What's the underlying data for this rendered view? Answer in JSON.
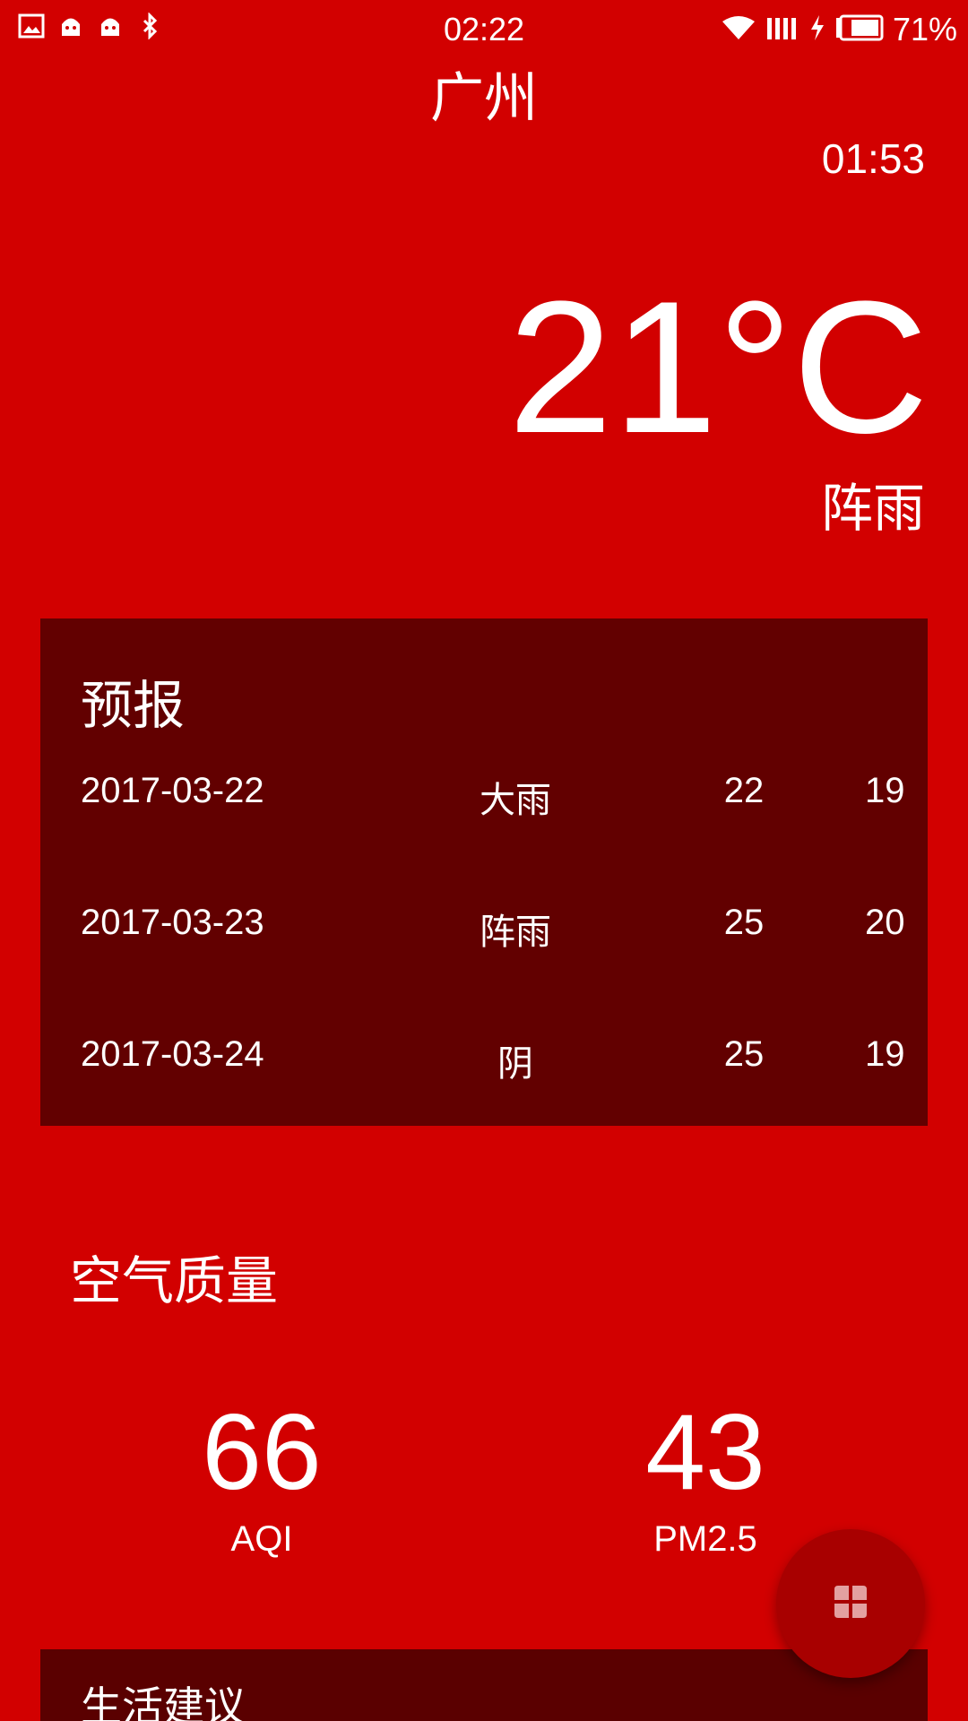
{
  "status_bar": {
    "time": "02:22",
    "battery_percent": "71%",
    "icons": [
      "image-icon",
      "android-icon",
      "android-icon",
      "bluetooth-icon",
      "wifi-icon",
      "signal-icon",
      "charging-icon",
      "battery-icon"
    ]
  },
  "weather": {
    "city": "广州",
    "update_time": "01:53",
    "temperature": "21°C",
    "condition": "阵雨"
  },
  "forecast": {
    "title": "预报",
    "rows": [
      {
        "date": "2017-03-22",
        "cond": "大雨",
        "max": "22",
        "min": "19"
      },
      {
        "date": "2017-03-23",
        "cond": "阵雨",
        "max": "25",
        "min": "20"
      },
      {
        "date": "2017-03-24",
        "cond": "阴",
        "max": "25",
        "min": "19"
      }
    ]
  },
  "air_quality": {
    "title": "空气质量",
    "aqi_value": "66",
    "aqi_label": "AQI",
    "pm25_value": "43",
    "pm25_label": "PM2.5"
  },
  "suggestion": {
    "title": "生活建议"
  },
  "colors": {
    "background": "#d20000",
    "card": "#620000",
    "fab": "#a80000"
  }
}
